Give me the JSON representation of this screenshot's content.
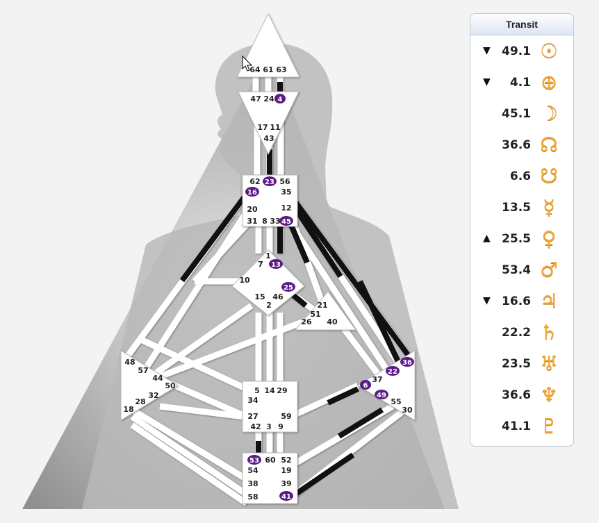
{
  "panel": {
    "title": "Transit",
    "rows": [
      {
        "arrow": "▼",
        "value": "49.1",
        "glyph": "☉",
        "icon": "sun-icon"
      },
      {
        "arrow": "▼",
        "value": "4.1",
        "glyph": "⊕",
        "icon": "earth-icon"
      },
      {
        "arrow": "",
        "value": "45.1",
        "glyph": "☽",
        "icon": "moon-icon"
      },
      {
        "arrow": "",
        "value": "36.6",
        "glyph": "☊",
        "icon": "north-node-icon"
      },
      {
        "arrow": "",
        "value": "6.6",
        "glyph": "☋",
        "icon": "south-node-icon"
      },
      {
        "arrow": "",
        "value": "13.5",
        "glyph": "☿",
        "icon": "mercury-icon"
      },
      {
        "arrow": "▲",
        "value": "25.5",
        "glyph": "♀",
        "icon": "venus-icon"
      },
      {
        "arrow": "",
        "value": "53.4",
        "glyph": "♂",
        "icon": "mars-icon"
      },
      {
        "arrow": "▼",
        "value": "16.6",
        "glyph": "♃",
        "icon": "jupiter-icon"
      },
      {
        "arrow": "",
        "value": "22.2",
        "glyph": "♄",
        "icon": "saturn-icon"
      },
      {
        "arrow": "",
        "value": "23.5",
        "glyph": "♅",
        "icon": "uranus-icon"
      },
      {
        "arrow": "",
        "value": "36.6",
        "glyph": "♆",
        "icon": "neptune-icon"
      },
      {
        "arrow": "",
        "value": "41.1",
        "glyph": "♇",
        "icon": "pluto-icon"
      }
    ]
  },
  "colors": {
    "active_gate": "#5b1a86",
    "glyph": "#f2a93b",
    "activated_channel": "#111111",
    "body_graph_fill": "#ffffff"
  },
  "gates": {
    "head": [
      "64",
      "61",
      "63"
    ],
    "ajna": [
      "47",
      "24",
      "4",
      "17",
      "11",
      "43"
    ],
    "throat": [
      "62",
      "23",
      "56",
      "16",
      "35",
      "20",
      "12",
      "31",
      "8",
      "33",
      "45"
    ],
    "g_center": [
      "1",
      "7",
      "13",
      "10",
      "25",
      "15",
      "46",
      "2"
    ],
    "heart": [
      "21",
      "51",
      "26",
      "40"
    ],
    "spleen": [
      "48",
      "57",
      "44",
      "50",
      "32",
      "28",
      "18"
    ],
    "solar_plexus": [
      "36",
      "22",
      "6",
      "37",
      "49",
      "55",
      "30"
    ],
    "sacral": [
      "5",
      "14",
      "29",
      "34",
      "27",
      "59",
      "42",
      "3",
      "9"
    ],
    "root": [
      "53",
      "60",
      "52",
      "54",
      "19",
      "38",
      "39",
      "58",
      "41"
    ]
  },
  "active_gates": [
    "4",
    "23",
    "16",
    "45",
    "13",
    "25",
    "36",
    "22",
    "6",
    "49",
    "53",
    "41"
  ]
}
